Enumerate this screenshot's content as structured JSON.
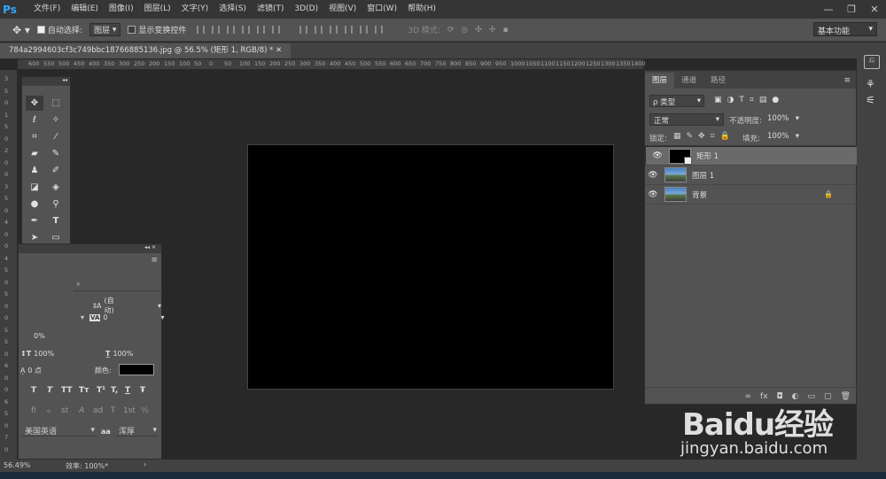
{
  "app": {
    "logo": "Ps"
  },
  "menu": [
    "文件(F)",
    "编辑(E)",
    "图像(I)",
    "图层(L)",
    "文字(Y)",
    "选择(S)",
    "滤镜(T)",
    "3D(D)",
    "视图(V)",
    "窗口(W)",
    "帮助(H)"
  ],
  "window_controls": {
    "minimize": "—",
    "restore": "❐",
    "close": "✕"
  },
  "options": {
    "auto_select_label": "自动选择:",
    "auto_select_value": "图层",
    "show_transform_label": "显示变换控件",
    "mode_3d_label": "3D 模式:",
    "workspace": "基本功能"
  },
  "document_tab": "784a2994603cf3c749bbc18766885136.jpg @ 56.5% (矩形 1, RGB/8) * ✕",
  "ruler_top": [
    "600",
    "550",
    "500",
    "450",
    "400",
    "350",
    "300",
    "250",
    "200",
    "150",
    "100",
    "50",
    "0",
    "50",
    "100",
    "150",
    "200",
    "250",
    "300",
    "350",
    "400",
    "450",
    "500",
    "550",
    "600",
    "650",
    "700",
    "750",
    "800",
    "850",
    "900",
    "950",
    "1000",
    "1050",
    "1100",
    "1150",
    "1200",
    "1250",
    "1300",
    "1350",
    "1400"
  ],
  "ruler_left": [
    "3",
    "5",
    "0",
    "1",
    "5",
    "0",
    "2",
    "0",
    "0",
    "3",
    "5",
    "0",
    "4",
    "0",
    "0",
    "4",
    "5",
    "0",
    "5",
    "0",
    "0",
    "5",
    "5",
    "0",
    "6",
    "0",
    "0",
    "6",
    "5",
    "0",
    "7",
    "0"
  ],
  "character_panel": {
    "leading": "(自动)",
    "tracking": "0",
    "vscale": "100%",
    "hscale": "100%",
    "baseline": "0 点",
    "color_label": "颜色:",
    "language": "美国英语",
    "antialias_label": "aa",
    "antialias": "浑厚",
    "percent_small": "0%",
    "type_styles": [
      "T",
      "T",
      "TT",
      "Tт",
      "T¹",
      "T,",
      "T",
      "Ŧ"
    ],
    "opentype": [
      "fi",
      "ℴ",
      "st",
      "A",
      "ad",
      "T",
      "1st",
      "½"
    ]
  },
  "layers_panel": {
    "tabs": [
      "图层",
      "通道",
      "路径"
    ],
    "filter": "ρ 类型",
    "blend_mode": "正常",
    "opacity_label": "不透明度:",
    "opacity": "100%",
    "lock_label": "锁定:",
    "fill_label": "填充:",
    "fill": "100%",
    "layers": [
      {
        "name": "矩形 1",
        "selected": true
      },
      {
        "name": "图层 1",
        "selected": false
      },
      {
        "name": "背景",
        "selected": false,
        "locked": true
      }
    ],
    "footer_icons": [
      "∞",
      "fx",
      "◘",
      "◐",
      "▭",
      "▢",
      "🗑"
    ]
  },
  "status": {
    "zoom": "56.49%",
    "efficiency": "效率: 100%*"
  },
  "watermark": {
    "brand": "Baidu经验",
    "url": "jingyan.baidu.com"
  }
}
